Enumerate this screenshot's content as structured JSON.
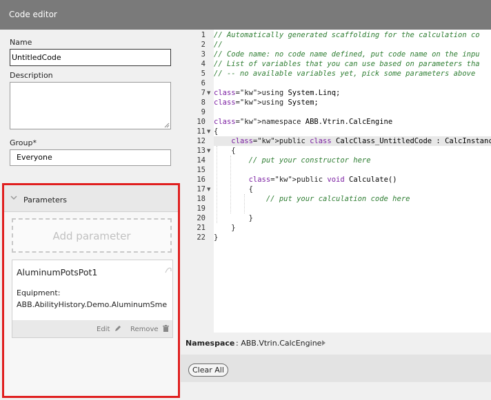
{
  "window": {
    "title": "Code editor"
  },
  "form": {
    "name_label": "Name",
    "name_value": "UntitledCode",
    "description_label": "Description",
    "description_value": "",
    "group_label": "Group*",
    "group_value": "Everyone"
  },
  "parameters": {
    "header": "Parameters",
    "add_label": "Add parameter",
    "items": [
      {
        "name": "AluminumPotsPot1",
        "equipment_label": "Equipment:",
        "equipment_value": "ABB.AbilityHistory.Demo.AluminumSme",
        "edit_label": "Edit",
        "remove_label": "Remove"
      }
    ]
  },
  "code": {
    "lines": [
      "// Automatically generated scaffolding for the calculation co",
      "//",
      "// Code name: no code name defined, put code name on the inpu",
      "// List of variables that you can use based on parameters tha",
      "// -- no available variables yet, pick some parameters above",
      "",
      "using System.Linq;",
      "using System;",
      "",
      "namespace ABB.Vtrin.CalcEngine",
      "{",
      "    public class CalcClass_UntitledCode : CalcInstance",
      "    {",
      "        // put your constructor here",
      "",
      "        public void Calculate()",
      "        {",
      "            // put your calculation code here",
      "",
      "        }",
      "    }",
      "}"
    ],
    "line_numbers": [
      "1",
      "2",
      "3",
      "4",
      "5",
      "6",
      "7",
      "8",
      "9",
      "10",
      "11",
      "12",
      "13",
      "14",
      "15",
      "16",
      "17",
      "18",
      "19",
      "20",
      "21",
      "22"
    ]
  },
  "namespace_bar": {
    "label": "Namespace",
    "value": ": ABB.Vtrin.CalcEngine"
  },
  "buttons": {
    "clear_all": "Clear All"
  },
  "colors": {
    "accent_border": "#e01e1e",
    "comment": "#2e7d32",
    "keyword": "#7b1fa2"
  }
}
